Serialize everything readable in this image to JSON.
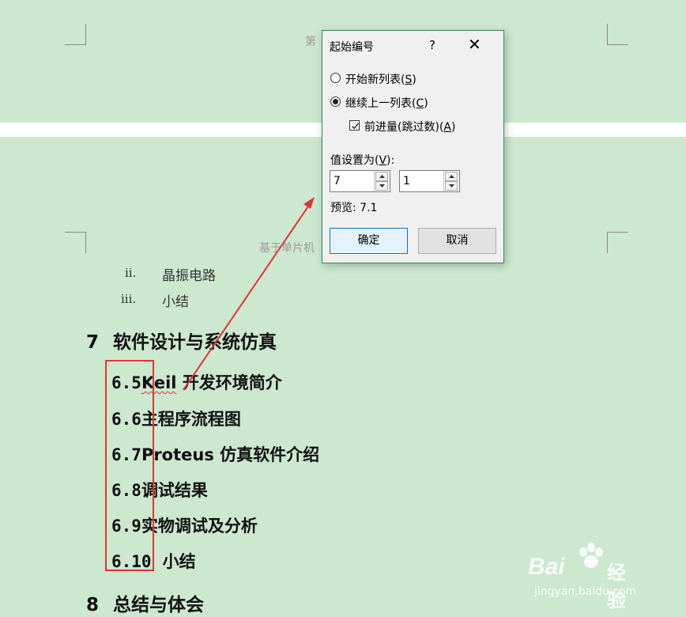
{
  "document": {
    "header_top": "第",
    "header_bottom": "基于单片机",
    "roman_items": [
      {
        "marker": "ii.",
        "label": "晶振电路"
      },
      {
        "marker": "iii.",
        "label": "小结"
      }
    ],
    "chapter7": {
      "number": "7",
      "title": "软件设计与系统仿真"
    },
    "sections": [
      {
        "number": "6.5",
        "title": "Keil",
        "rest": " 开发环境简介"
      },
      {
        "number": "6.6",
        "title": "主程序流程图",
        "rest": ""
      },
      {
        "number": "6.7",
        "title": "Proteus 仿真软件介绍",
        "rest": ""
      },
      {
        "number": "6.8",
        "title": "调试结果",
        "rest": ""
      },
      {
        "number": "6.9",
        "title": "实物调试及分析",
        "rest": ""
      },
      {
        "number": "6.10",
        "title": "小结",
        "rest": ""
      }
    ],
    "chapter8": {
      "number": "8",
      "title": "总结与体会"
    }
  },
  "dialog": {
    "title": "起始编号",
    "help": "?",
    "close": "✕",
    "option_new_list": {
      "text": "开始新列表(",
      "key": "S",
      "end": ")",
      "selected": false
    },
    "option_continue": {
      "text": "继续上一列表(",
      "key": "C",
      "end": ")",
      "selected": true
    },
    "option_advance": {
      "text": "前进量(跳过数)(",
      "key": "A",
      "end": ")",
      "checked": true
    },
    "value_label": {
      "text": "值设置为(",
      "key": "V",
      "end": "):"
    },
    "spinner1_value": "7",
    "spinner2_value": "1",
    "preview": "预览: 7.1",
    "ok_button": "确定",
    "cancel_button": "取消"
  },
  "watermark": {
    "brand": "Bai",
    "brand_suffix": "经验",
    "url": "jingyan.baidu.com"
  },
  "colors": {
    "page_background": "#cce8cf",
    "annotation_red": "#e03535",
    "dialog_border": "#2e8b57",
    "primary_button_border": "#0078d7"
  }
}
